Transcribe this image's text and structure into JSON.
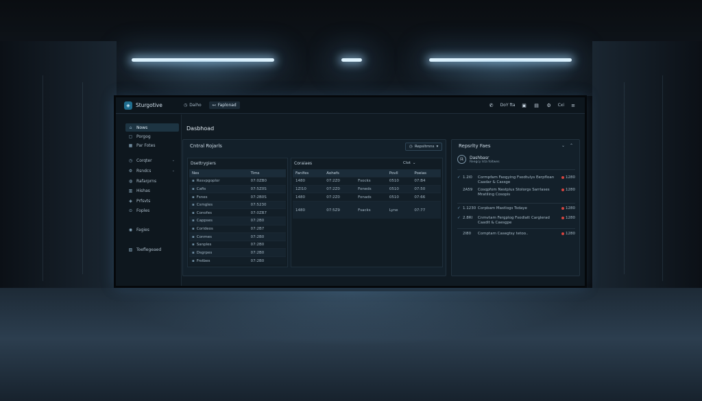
{
  "app": {
    "name": "Sturgotive",
    "logo_icon": "shield-logo-icon"
  },
  "top_nav": [
    {
      "icon": "clock-icon",
      "glyph": "◷",
      "label": "Daiho",
      "active": false
    },
    {
      "icon": "arrow-icon",
      "glyph": "↤",
      "label": "Faplonad",
      "active": true
    }
  ],
  "top_right": {
    "call_glyph": "✆",
    "user_label": "DoY fta",
    "box_glyph": "▣",
    "doc_glyph": "▤",
    "gear_label": "Cxi",
    "menu_glyph": "≡"
  },
  "sidebar": {
    "items": [
      {
        "icon": "home-icon",
        "glyph": "⌂",
        "label": "Nows",
        "active": true,
        "chevron": ""
      },
      {
        "icon": "box-icon",
        "glyph": "▢",
        "label": "Porgog",
        "active": false,
        "chevron": ""
      },
      {
        "icon": "grid-icon",
        "glyph": "▦",
        "label": "Par Fotes",
        "active": false,
        "chevron": ""
      },
      {
        "icon": "clock-icon",
        "glyph": "◷",
        "label": "Corqter",
        "active": false,
        "chevron": "⌄"
      },
      {
        "icon": "gear-icon",
        "glyph": "⚙",
        "label": "Rsndcs",
        "active": false,
        "chevron": "⌄"
      },
      {
        "icon": "globe-icon",
        "glyph": "◍",
        "label": "Rafarprns",
        "active": false,
        "chevron": ""
      },
      {
        "icon": "chart-icon",
        "glyph": "▥",
        "label": "Hishas",
        "active": false,
        "chevron": ""
      },
      {
        "icon": "shield-icon",
        "glyph": "◈",
        "label": "Prfsvts",
        "active": false,
        "chevron": ""
      },
      {
        "icon": "pin-icon",
        "glyph": "⊙",
        "label": "Foples",
        "active": false,
        "chevron": ""
      },
      {
        "icon": "circle-icon",
        "glyph": "◉",
        "label": "Fagies",
        "active": false,
        "chevron": ""
      },
      {
        "icon": "folder-icon",
        "glyph": "▧",
        "label": "Toeflegeaed",
        "active": false,
        "chevron": ""
      }
    ]
  },
  "main": {
    "title": "Dasbhoad",
    "central": {
      "title": "Cntral Rojarls",
      "filter_glyph": "◷",
      "filter_label": "Repsltmns",
      "filter_caret": "▾",
      "left_table": {
        "title": "Dsettrygiers",
        "headers": [
          "Nes",
          "Tims"
        ],
        "rows": [
          [
            "Rssvpgoplor",
            "07:0ZB0"
          ],
          [
            "Cafis",
            "07:5Z0S"
          ],
          [
            "Fsnes",
            "07:2B0S"
          ],
          [
            "Csmgles",
            "07:5230"
          ],
          [
            "Conofes",
            "07:0ZB7"
          ],
          [
            "Cappses",
            "07:2B0"
          ],
          [
            "Corideos",
            "07:2B7"
          ],
          [
            "Conmes",
            "07:2B0"
          ],
          [
            "Sanples",
            "07:2B0"
          ],
          [
            "Dsgrpes",
            "07:2B0"
          ],
          [
            "Frstbes",
            "07:2B0"
          ]
        ]
      },
      "right_table": {
        "title": "Coraiaes",
        "close_label": "Clot",
        "headers": [
          "Fanifes",
          "Aohefs",
          "",
          "Povll",
          "Poeias"
        ],
        "rows": [
          [
            "1480",
            "07:2Z0",
            "Fsocks",
            "0510",
            "07:B4"
          ],
          [
            "1ZI10",
            "07:2Z0",
            "Foneds",
            "0510",
            "07:50"
          ],
          [
            "1480",
            "07:2Z0",
            "Fonads",
            "0510",
            "07:66"
          ],
          [
            "1480",
            "07:5Z9",
            "Fsacks",
            "Lyne",
            "07:77"
          ]
        ]
      }
    },
    "report": {
      "title": "Repsrlty Faes",
      "header_name": "Dashbasr",
      "header_sub": "Reegcy lsta foltwes",
      "rows": [
        {
          "check": "✓",
          "value": "1.2I0",
          "desc": "Cormpfam Faogying Fsodtulys Eerpfloan Caadar & Cassge",
          "status": "1280"
        },
        {
          "check": "",
          "value": "2A59",
          "desc": "Cosqpfom Nestplus Stolorgs Sarrlases Mratiling Cosopis",
          "status": "1280"
        },
        {
          "check": "✓",
          "value": "1.1230",
          "desc": "Corpbam Mastlogs Tsdaye",
          "status": "1280"
        },
        {
          "check": "✓",
          "value": "2.8RI",
          "desc": "Cnmvtam Fergplog Fsodlatt Carglerad Caadit & Caesgpe",
          "status": "1280"
        },
        {
          "check": "",
          "value": "2I80",
          "desc": "Comptam Casegtsy tetoo..",
          "status": "1280"
        }
      ]
    }
  }
}
